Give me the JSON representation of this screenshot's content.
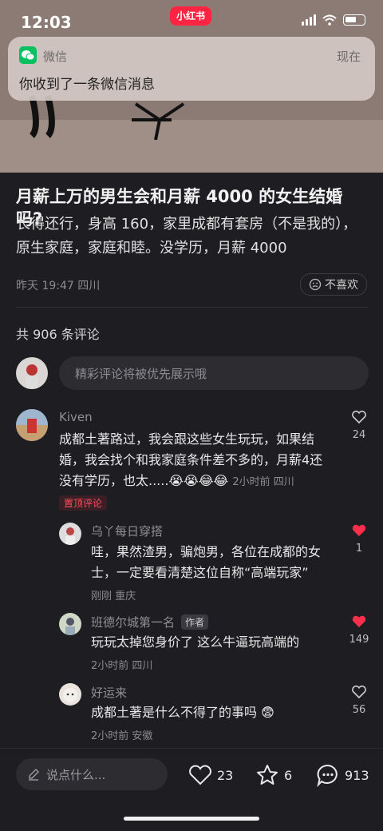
{
  "status_bar": {
    "time": "12:03",
    "app_badge": "小红书"
  },
  "notification": {
    "app": "微信",
    "time": "现在",
    "message": "你收到了一条微信消息"
  },
  "post": {
    "title": "月薪上万的男生会和月薪 4000 的女生结婚吗?",
    "body": "长得还行，身高 160，家里成都有套房（不是我的），原生家庭，家庭和睦。没学历，月薪 4000",
    "meta": "昨天 19:47 四川",
    "dislike_label": "不喜欢"
  },
  "comments_header": {
    "count_text": "共 906 条评论",
    "input_placeholder": "精彩评论将被优先展示哦"
  },
  "comments": [
    {
      "name": "Kiven",
      "text": "成都土著路过，我会跟这些女生玩玩，如果结婚，我会找个和我家庭条件差不多的，月薪4还没有学历，也太.....😭😭😂😂",
      "meta": "2小时前 四川",
      "likes": "24",
      "pinned_label": "置顶评论"
    }
  ],
  "replies": [
    {
      "name": "乌丫每日穿搭",
      "text": "哇，果然渣男，骗炮男，各位在成都的女士，一定要看清楚这位自称“高端玩家”",
      "meta": "刚刚 重庆",
      "likes": "1",
      "liked": true
    },
    {
      "name": "班德尔城第一名",
      "tag": "作者",
      "text": "玩玩太掉您身价了  这么牛逼玩高端的",
      "meta": "2小时前 四川",
      "likes": "149",
      "liked": true
    },
    {
      "name": "好运来",
      "text": "成都土著是什么不得了的事吗 😨",
      "meta": "2小时前 安徽",
      "likes": "56",
      "liked": false
    }
  ],
  "bottom_bar": {
    "say_placeholder": "说点什么...",
    "likes": "23",
    "collects": "6",
    "comments": "913"
  },
  "colors": {
    "brand": "#ff2442",
    "like_red": "#ff2e4d",
    "background": "#1e1e22"
  }
}
